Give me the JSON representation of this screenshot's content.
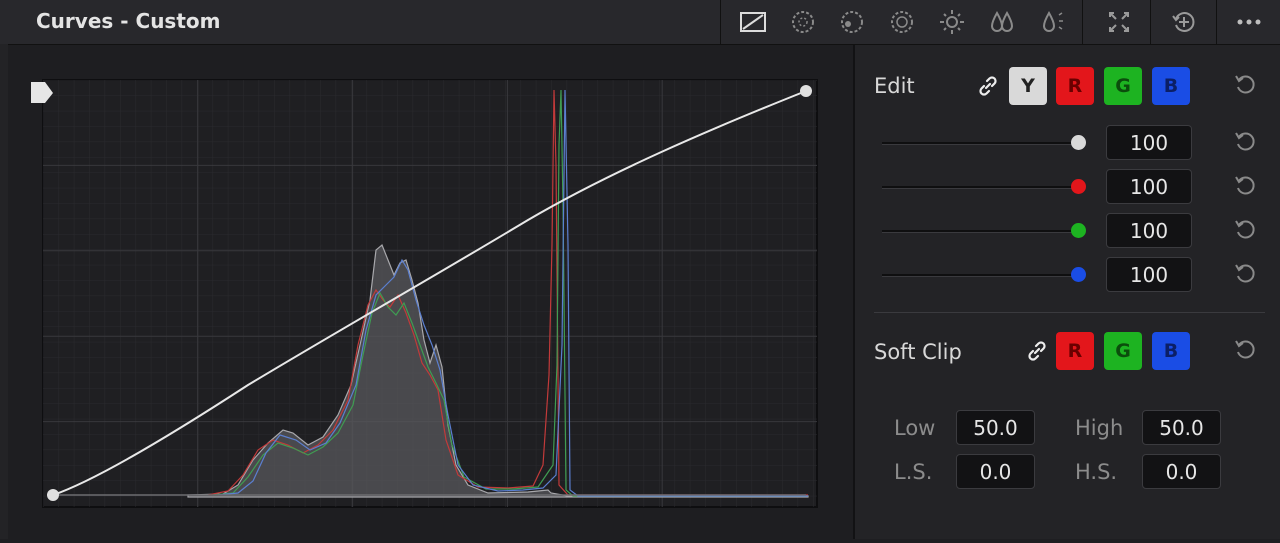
{
  "panel": {
    "title": "Curves - Custom"
  },
  "toolbar": {
    "icons": [
      "curves-mode-icon",
      "hue-vs-hue-icon",
      "hue-vs-sat-icon",
      "hue-vs-lum-icon",
      "lum-vs-sat-icon",
      "sat-vs-sat-icon",
      "sat-vs-lum-icon",
      "expand-icon",
      "add-node-icon",
      "more-options-icon"
    ]
  },
  "edit": {
    "label": "Edit",
    "channels": [
      "Y",
      "R",
      "G",
      "B"
    ],
    "selected_channel": "Y",
    "intensities": [
      {
        "channel": "Y",
        "value": "100",
        "color": "#d9d9d9"
      },
      {
        "channel": "R",
        "value": "100",
        "color": "#e3161b"
      },
      {
        "channel": "G",
        "value": "100",
        "color": "#1db321"
      },
      {
        "channel": "B",
        "value": "100",
        "color": "#1a4de5"
      }
    ]
  },
  "soft_clip": {
    "label": "Soft Clip",
    "channels": [
      "R",
      "G",
      "B"
    ],
    "low_label": "Low",
    "low_value": "50.0",
    "high_label": "High",
    "high_value": "50.0",
    "ls_label": "L.S.",
    "ls_value": "0.0",
    "hs_label": "H.S.",
    "hs_value": "0.0"
  },
  "colors": {
    "accent_gray": "#d9d9d9",
    "red": "#e3161b",
    "green": "#1db321",
    "blue": "#1a4de5"
  }
}
